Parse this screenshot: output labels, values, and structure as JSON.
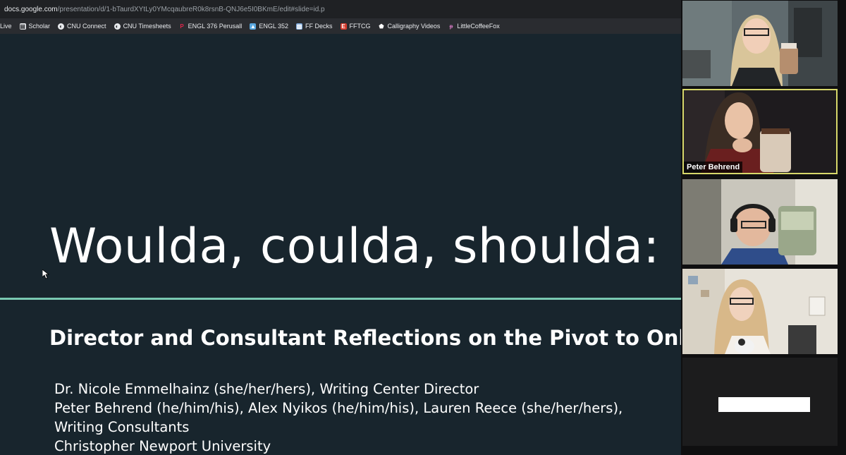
{
  "browser": {
    "url_host": "docs.google.com",
    "url_path": "/presentation/d/1-bTaurdXYtLy0YMcqaubreR0k8rsnB-QNJ6e5I0BKmE/edit#slide=id.p"
  },
  "bookmarks": [
    {
      "label": "Live",
      "icon": "none"
    },
    {
      "label": "Scholar",
      "icon": "scholar-icon"
    },
    {
      "label": "CNU Connect",
      "icon": "globe-icon"
    },
    {
      "label": "CNU Timesheets",
      "icon": "globe-icon"
    },
    {
      "label": "ENGL 376 Perusall",
      "icon": "perusall-icon"
    },
    {
      "label": "ENGL 352",
      "icon": "image-icon"
    },
    {
      "label": "FF Decks",
      "icon": "deck-icon"
    },
    {
      "label": "FFTCG",
      "icon": "fftcg-icon"
    },
    {
      "label": "Calligraphy Videos",
      "icon": "pentagon-icon"
    },
    {
      "label": "LittleCoffeeFox",
      "icon": "fox-icon"
    }
  ],
  "slide": {
    "title": "Woulda, coulda, shoulda:",
    "subtitle": "Director and Consultant Reflections on the Pivot to Online Tutoring",
    "authors": [
      "Dr. Nicole Emmelhainz (she/her/hers), Writing Center Director",
      "Peter Behrend (he/him/his), Alex Nyikos (he/him/his), Lauren Reece (she/her/hers),",
      "Writing Consultants",
      "Christopher Newport University"
    ],
    "rule_color": "#79c9b1"
  },
  "participants": [
    {
      "name": "",
      "active": false
    },
    {
      "name": "Peter Behrend",
      "active": true
    },
    {
      "name": "",
      "active": false
    },
    {
      "name": "",
      "active": false
    },
    {
      "name": "",
      "active": false
    }
  ],
  "colors": {
    "slide_bg": "#18252d",
    "accent": "#79c9b1",
    "active_speaker": "#d7d86a"
  }
}
